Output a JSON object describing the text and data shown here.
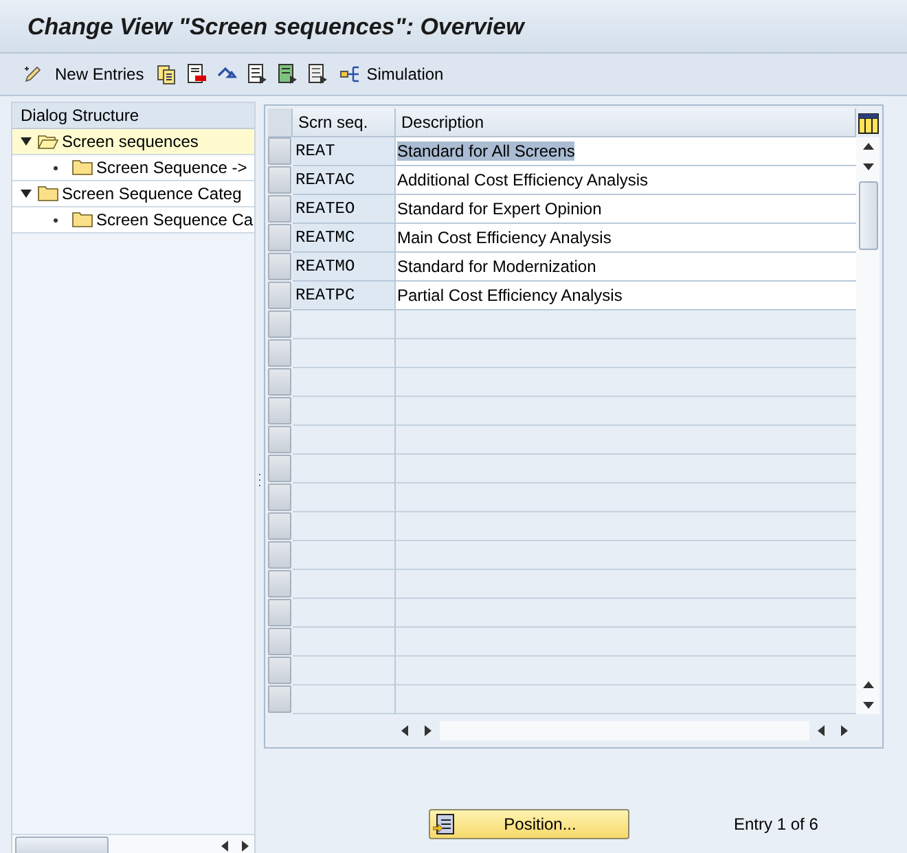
{
  "window": {
    "title": "Change View \"Screen sequences\": Overview"
  },
  "toolbar": {
    "new_entries": "New Entries",
    "simulation": "Simulation"
  },
  "dialog_structure": {
    "title": "Dialog Structure",
    "items": [
      {
        "label": "Screen sequences",
        "expanded": true,
        "selected": true,
        "children": [
          {
            "label": "Screen Sequence ->",
            "selected": false
          }
        ]
      },
      {
        "label": "Screen Sequence Categ",
        "expanded": true,
        "selected": false,
        "children": [
          {
            "label": "Screen Sequence Ca",
            "selected": false
          }
        ]
      }
    ]
  },
  "table": {
    "columns": [
      "Scrn seq.",
      "Description"
    ],
    "rows": [
      {
        "cells": [
          "REAT",
          "Standard for All Screens"
        ],
        "highlighted": true
      },
      {
        "cells": [
          "REATAC",
          "Additional Cost Efficiency Analysis"
        ],
        "highlighted": false
      },
      {
        "cells": [
          "REATEO",
          "Standard for Expert Opinion"
        ],
        "highlighted": false
      },
      {
        "cells": [
          "REATMC",
          "Main Cost Efficiency Analysis"
        ],
        "highlighted": false
      },
      {
        "cells": [
          "REATMO",
          "Standard for Modernization"
        ],
        "highlighted": false
      },
      {
        "cells": [
          "REATPC",
          "Partial Cost Efficiency Analysis"
        ],
        "highlighted": false
      }
    ]
  },
  "footer": {
    "position_button": "Position...",
    "entry_info": "Entry 1 of 6"
  }
}
